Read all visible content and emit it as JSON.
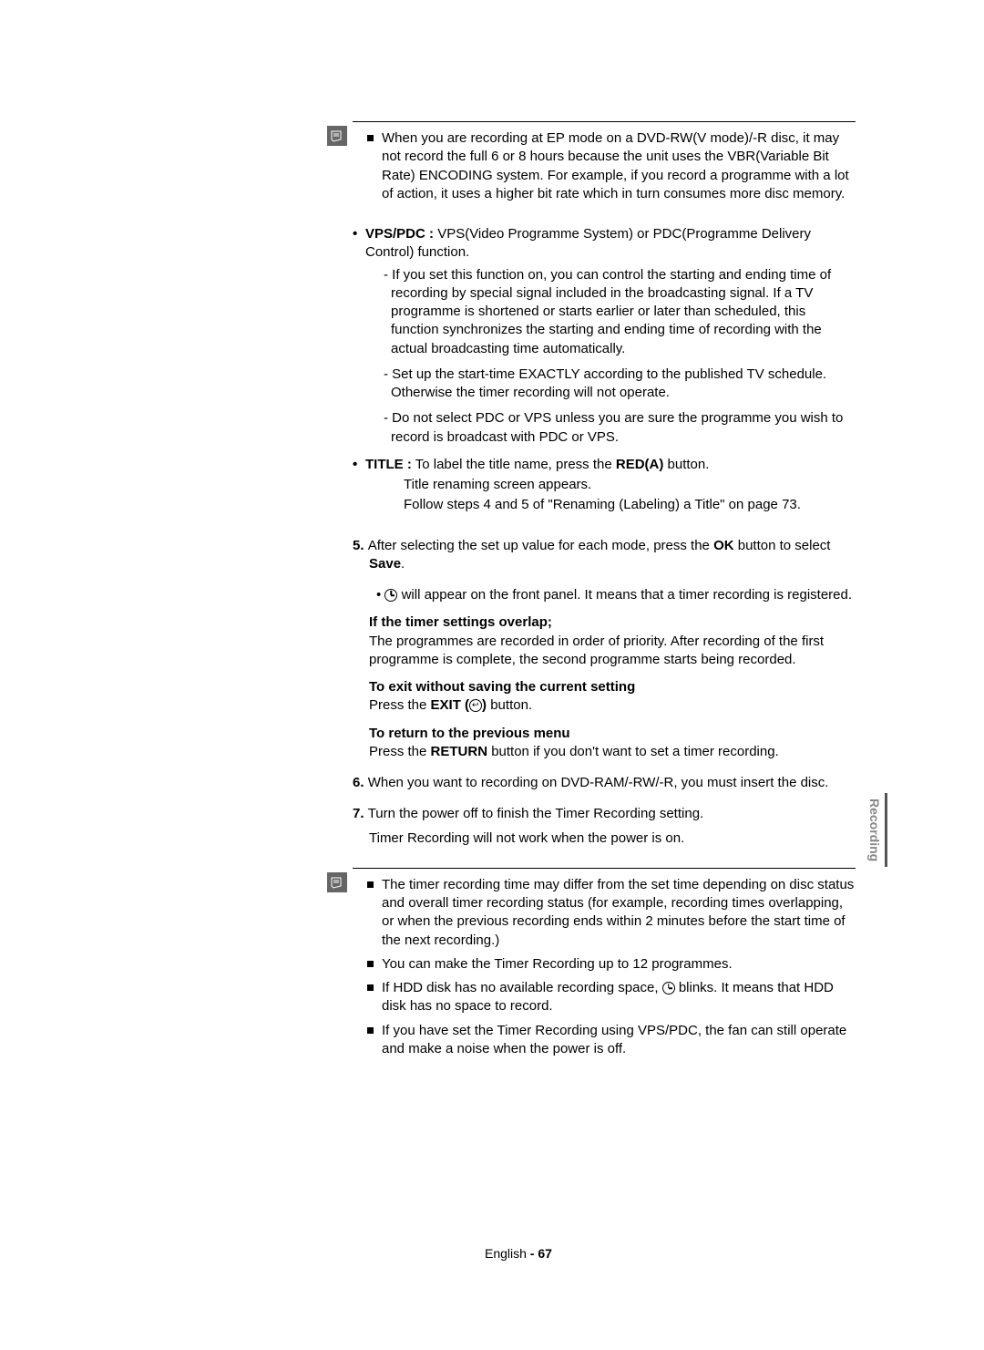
{
  "note1": {
    "text": "When you are recording at EP mode on a DVD-RW(V mode)/-R disc, it may not record the full 6 or 8 hours because the unit uses the VBR(Variable Bit Rate) ENCODING system. For example, if you record a programme with a lot of action, it uses a higher bit rate which in turn consumes more disc memory."
  },
  "vpspdc": {
    "label": "VPS/PDC :",
    "text": "VPS(Video Programme System) or PDC(Programme Delivery Control) function.",
    "sub1": "- If you set this function on, you can control the starting and ending time of recording by special signal included in the broadcasting signal. If a TV programme is shortened or starts earlier or later than scheduled, this function synchronizes the starting and ending time of recording with the actual broadcasting time automatically.",
    "sub2": "- Set up the start-time EXACTLY according to the published TV schedule. Otherwise the timer recording will not operate.",
    "sub3": "- Do not select PDC or VPS unless you are sure the programme you wish to record is broadcast with PDC or VPS."
  },
  "title": {
    "label": "TITLE :",
    "text1": "To label the title name, press the ",
    "red": "RED(A)",
    "text2": " button.",
    "line2": "Title renaming screen appears.",
    "line3": "Follow steps 4 and 5 of \"Renaming (Labeling) a Title\" on page 73."
  },
  "step5": {
    "num": "5.",
    "text1": "After selecting the set up value for each mode, press the ",
    "ok": "OK",
    "text2": " button to select ",
    "save": "Save",
    "text3": ".",
    "sub": " will appear on the front panel. It means that a timer recording is registered."
  },
  "overlap": {
    "heading": "If the timer settings overlap;",
    "text": "The programmes are recorded in order of priority. After recording of the first programme is complete, the second programme starts being recorded."
  },
  "exit": {
    "heading": "To exit without saving the current setting",
    "text1": "Press the ",
    "exit": "EXIT (",
    "text2": ")",
    "text3": " button."
  },
  "return": {
    "heading": "To return to the previous menu",
    "text1": "Press the ",
    "return_btn": "RETURN",
    "text2": " button if you don't want to set a timer recording."
  },
  "step6": {
    "num": "6.",
    "text": "When you want to recording on DVD-RAM/-RW/-R, you must insert the disc."
  },
  "step7": {
    "num": "7.",
    "text1": "Turn the power off to finish the Timer Recording setting.",
    "text2": "Timer Recording will not work when the power is on."
  },
  "note2": {
    "item1": "The timer recording time may differ from the set time depending on disc status and overall timer recording status (for example, recording times overlapping, or when the previous recording ends within 2 minutes before the start time of the next recording.)",
    "item2": "You can make the Timer Recording up to 12 programmes.",
    "item3a": "If HDD disk has no available recording space, ",
    "item3b": " blinks. It means that HDD disk has no space to record.",
    "item4": "If you have set the Timer Recording using VPS/PDC, the fan can still operate and make a noise when the power is off."
  },
  "sidetab": "Recording",
  "footer": {
    "lang": "English",
    "dash": " - ",
    "page": "67"
  }
}
